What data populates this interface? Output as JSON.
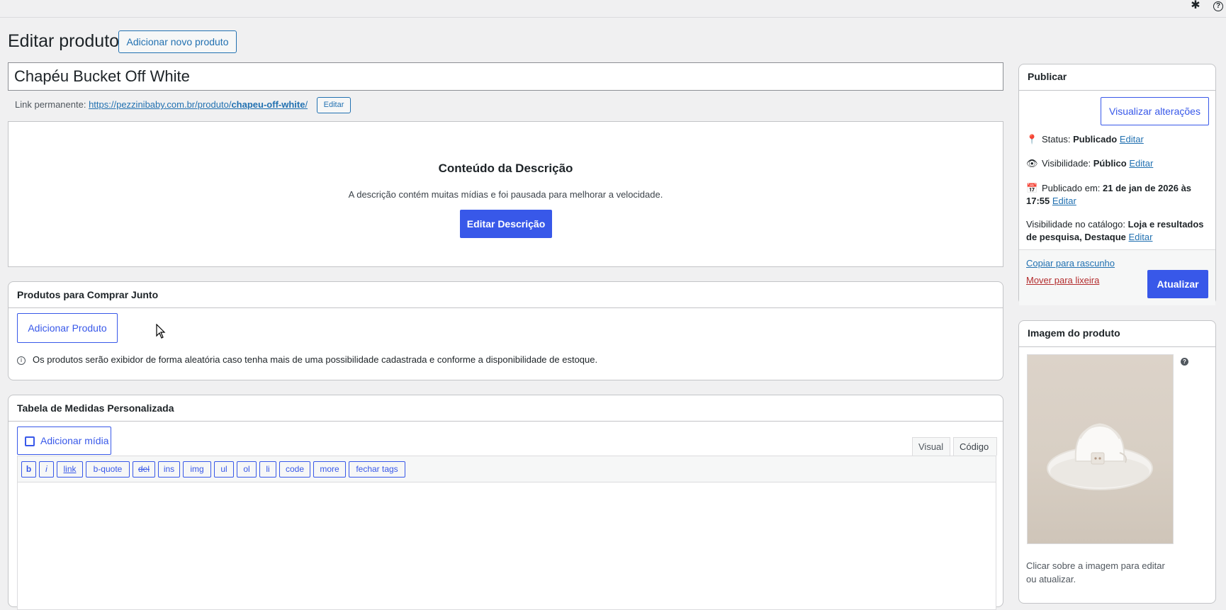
{
  "toolbar": {
    "settings_icon": "gear-icon",
    "help_icon": "help-icon"
  },
  "header": {
    "title": "Editar produto",
    "add_new_label": "Adicionar novo produto"
  },
  "product": {
    "title": "Chapéu Bucket Off White",
    "permalink_label": "Link permanente:",
    "permalink_base": "https://pezzinibaby.com.br/produto/",
    "permalink_slug": "chapeu-off-white",
    "permalink_trailing": "/",
    "permalink_edit_label": "Editar"
  },
  "description": {
    "heading": "Conteúdo da Descrição",
    "text": "A descrição contém muitas mídias e foi pausada para melhorar a velocidade.",
    "edit_label": "Editar Descrição"
  },
  "bundle": {
    "title": "Produtos para Comprar Junto",
    "add_label": "Adicionar Produto",
    "info_text": "Os produtos serão exibidor de forma aleatória caso tenha mais de uma possibilidade cadastrada e conforme a disponibilidade de estoque."
  },
  "size_table": {
    "title": "Tabela de Medidas Personalizada",
    "add_media_label": "Adicionar mídia",
    "tab_visual": "Visual",
    "tab_code": "Código",
    "quicktags": [
      "b",
      "i",
      "link",
      "b-quote",
      "del",
      "ins",
      "img",
      "ul",
      "ol",
      "li",
      "code",
      "more",
      "fechar tags"
    ]
  },
  "publish": {
    "title": "Publicar",
    "preview_label": "Visualizar alterações",
    "status_label": "Status:",
    "status_value": "Publicado",
    "visibility_label": "Visibilidade:",
    "visibility_value": "Público",
    "published_label": "Publicado em:",
    "published_value": "21 de jan de 2026 às 17:55",
    "catalog_label": "Visibilidade no catálogo:",
    "catalog_value": "Loja e resultados de pesquisa, Destaque",
    "edit_label": "Editar",
    "copy_label": "Copiar para rascunho",
    "trash_label": "Mover para lixeira",
    "update_label": "Atualizar"
  },
  "product_image": {
    "title": "Imagem do produto",
    "caption": "Clicar sobre a imagem para editar ou atualizar."
  },
  "colors": {
    "primary": "#3858e9",
    "link": "#2271b1",
    "trash": "#b32d2e",
    "bg": "#f0f0f1"
  }
}
